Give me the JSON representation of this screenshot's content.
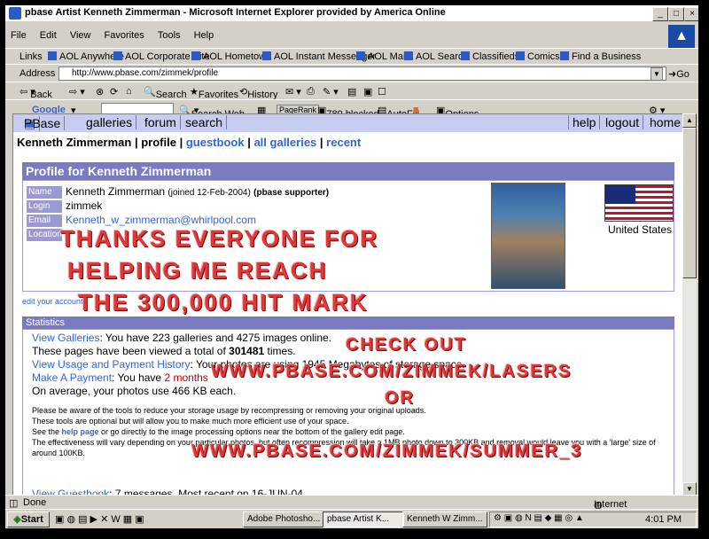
{
  "window": {
    "title": "pbase Artist Kenneth Zimmerman - Microsoft Internet Explorer provided by America Online",
    "controls": [
      "_",
      "□",
      "×"
    ]
  },
  "menu": [
    "File",
    "Edit",
    "View",
    "Favorites",
    "Tools",
    "Help"
  ],
  "links_bar": {
    "label": "Links",
    "items": [
      "AOL Anywhere",
      "AOL Corporate Site",
      "AOL Hometown",
      "AOL Instant Messenger",
      "AOL Mail",
      "AOL Search",
      "Classifieds",
      "Comics",
      "Find a Business"
    ]
  },
  "address": {
    "label": "Address",
    "url": "http://www.pbase.com/zimmek/profile",
    "go": "Go"
  },
  "nav_toolbar": {
    "back": "Back",
    "search": "Search",
    "favorites": "Favorites",
    "history": "History"
  },
  "google_toolbar": {
    "brand": "Google",
    "search_web": "Search Web",
    "pagerank": "PageRank",
    "blocked": "789 blocked",
    "autofill": "AutoFill",
    "options": "Options"
  },
  "pbase_nav": {
    "left": [
      "PBase",
      "galleries",
      "forum",
      "search"
    ],
    "right": [
      "help",
      "logout",
      "home"
    ]
  },
  "breadcrumb": {
    "name": "Kenneth Zimmerman",
    "sep": "|",
    "profile": "profile",
    "guestbook": "guestbook",
    "all_galleries": "all galleries",
    "recent": "recent"
  },
  "profile": {
    "header": "Profile for Kenneth Zimmerman",
    "name_label": "Name",
    "name_value": "Kenneth Zimmerman",
    "joined": "(joined 12-Feb-2004)",
    "supporter": "(pbase supporter)",
    "login_label": "Login",
    "login_value": "zimmek",
    "email_label": "Email",
    "email_value": "Kenneth_w_zimmerman@whirlpool.com",
    "location_label": "Location",
    "location_value": "",
    "country": "United States",
    "edit_links": "edit your account"
  },
  "stats": {
    "header": "Statistics",
    "galleries_link": "View Galleries",
    "galleries_text": ": You have 223 galleries and 4275 images online.",
    "views_prefix": "These pages have been viewed a total of ",
    "views_count": "301481",
    "views_suffix": " times.",
    "usage_link": "View Usage and Payment History",
    "usage_text": ": Your photos are using 1945 Megabytes of storage space.",
    "payment_link": "Make A Payment",
    "payment_prefix": ": You have ",
    "payment_remaining": "2 months",
    "average": "On average, your photos use 466 KB each.",
    "note1": "Please be aware of the tools to reduce your storage usage by recompressing or removing your original uploads.",
    "note2": "These tools are optional but will allow you to make much more efficient use of your space.",
    "note3_prefix": "See the ",
    "note3_link": "help page",
    "note3_suffix": " or go directly to the image processing options near the bottom of the gallery edit page.",
    "note4": "The effectiveness will vary depending on your particular photos, but often recompression will take a 1MB photo down to 300KB and removal would leave you with a 'large' size of",
    "note5": "around 100KB.",
    "guestbook_link": "View Guestbook",
    "guestbook_text": ": 7 messages. Most recent on 16-JUN-04."
  },
  "overlay": {
    "line1": "THANKS EVERYONE FOR",
    "line2": "HELPING  ME REACH",
    "line3": "THE 300,000 HIT MARK",
    "check1": "CHECK OUT",
    "check2": "WWW.PBASE.COM/ZIMMEK/LASERS",
    "check3": "OR",
    "check4": "WWW.PBASE.COM/ZIMMEK/SUMMER_3"
  },
  "status": {
    "left": "Done",
    "zone": "Internet"
  },
  "taskbar": {
    "start": "Start",
    "windows": [
      "Adobe Photosho...",
      "pbase Artist K...",
      "Kenneth W Zimm..."
    ],
    "clock": "4:01 PM"
  }
}
